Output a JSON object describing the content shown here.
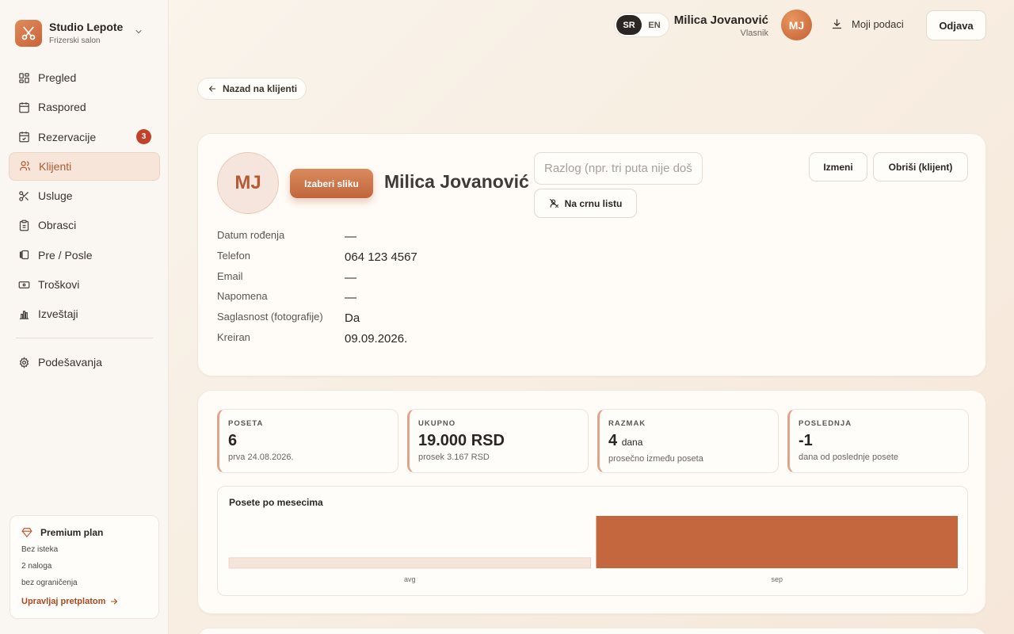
{
  "brand": {
    "name": "Studio Lepote",
    "subtitle": "Frizerski salon",
    "logo_icon": "scissors-icon"
  },
  "sidebar": {
    "items": [
      {
        "label": "Pregled",
        "icon": "grid-icon"
      },
      {
        "label": "Raspored",
        "icon": "calendar-icon"
      },
      {
        "label": "Rezervacije",
        "icon": "calendar-check-icon",
        "badge": "3"
      },
      {
        "label": "Klijenti",
        "icon": "users-icon",
        "active": true
      },
      {
        "label": "Usluge",
        "icon": "scissors-icon"
      },
      {
        "label": "Obrasci",
        "icon": "clipboard-icon"
      },
      {
        "label": "Pre / Posle",
        "icon": "compare-icon"
      },
      {
        "label": "Troškovi",
        "icon": "banknote-icon"
      },
      {
        "label": "Izveštaji",
        "icon": "bar-chart-icon"
      }
    ],
    "settings": {
      "label": "Podešavanja",
      "icon": "gear-icon"
    }
  },
  "plan": {
    "title": "Premium plan",
    "lines": [
      "Bez isteka",
      "2 naloga",
      "bez ograničenja"
    ],
    "manage_label": "Upravljaj pretplatom"
  },
  "topbar": {
    "lang": [
      "SR",
      "EN"
    ],
    "active_lang": "SR",
    "user_name": "Milica Jovanović",
    "user_role": "Vlasnik",
    "user_initials": "MJ",
    "my_data_label": "Moji podaci",
    "logout_label": "Odjava"
  },
  "back_label": "Nazad na klijenti",
  "profile": {
    "initials": "MJ",
    "pick_photo_label": "Izaberi sliku",
    "name": "Milica Jovanović",
    "reason_placeholder": "Razlog (npr. tri puta nije došla)",
    "blacklist_label": "Na crnu listu",
    "edit_label": "Izmeni",
    "delete_label": "Obriši (klijent)",
    "details": [
      {
        "label": "Datum rođenja",
        "value": "—"
      },
      {
        "label": "Telefon",
        "value": "064 123 4567"
      },
      {
        "label": "Email",
        "value": "—"
      },
      {
        "label": "Napomena",
        "value": "—"
      },
      {
        "label": "Saglasnost (fotografije)",
        "value": "Da"
      },
      {
        "label": "Kreiran",
        "value": "09.09.2026."
      }
    ]
  },
  "stats": [
    {
      "label": "POSETA",
      "value": "6",
      "unit": "",
      "sub": "prva 24.08.2026."
    },
    {
      "label": "UKUPNO",
      "value": "19.000 RSD",
      "unit": "",
      "sub": "prosek 3.167 RSD"
    },
    {
      "label": "RAZMAK",
      "value": "4",
      "unit": "dana",
      "sub": "prosečno između poseta"
    },
    {
      "label": "POSLEDNJA",
      "value": "-1",
      "unit": "",
      "sub": "dana od poslednje posete"
    }
  ],
  "chart_data": {
    "type": "bar",
    "title": "Posete po mesecima",
    "categories": [
      "avg",
      "sep"
    ],
    "values": [
      1,
      5
    ],
    "colors": [
      "#f6e3da",
      "#c4673e"
    ],
    "ylim": [
      0,
      5
    ]
  },
  "colors": {
    "accent": "#c4673e",
    "badge": "#c2412a",
    "active_nav_bg": "#f6e5d8"
  }
}
